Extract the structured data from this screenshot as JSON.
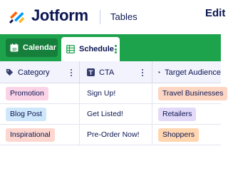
{
  "header": {
    "logo_text": "Jotform",
    "product_name": "Tables",
    "edit_label": "Edit"
  },
  "tabs": [
    {
      "label": "Calendar",
      "icon": "calendar-icon",
      "active": false
    },
    {
      "label": "Schedule",
      "icon": "grid-icon",
      "active": true
    }
  ],
  "table": {
    "columns": [
      {
        "label": "Category",
        "icon": "tag-icon"
      },
      {
        "label": "CTA",
        "icon": "text-icon"
      },
      {
        "label": "Target Audience",
        "icon": "tag-icon"
      }
    ],
    "rows": [
      {
        "category": "Promotion",
        "cta": "Sign Up!",
        "audience": "Travel Businesses"
      },
      {
        "category": "Blog Post",
        "cta": "Get Listed!",
        "audience": "Retailers"
      },
      {
        "category": "Inspirational",
        "cta": "Pre-Order Now!",
        "audience": "Shoppers"
      }
    ]
  },
  "colors": {
    "brand_navy": "#0a1551",
    "tab_bar_green": "#1ea34d",
    "pill_promotion": "#fbd3e6",
    "pill_blog_post": "#cfe7fb",
    "pill_inspirational": "#fdd7cf",
    "pill_travel_businesses": "#fdd5c3",
    "pill_retailers": "#e3daf9",
    "pill_shoppers": "#ffd6b0"
  }
}
